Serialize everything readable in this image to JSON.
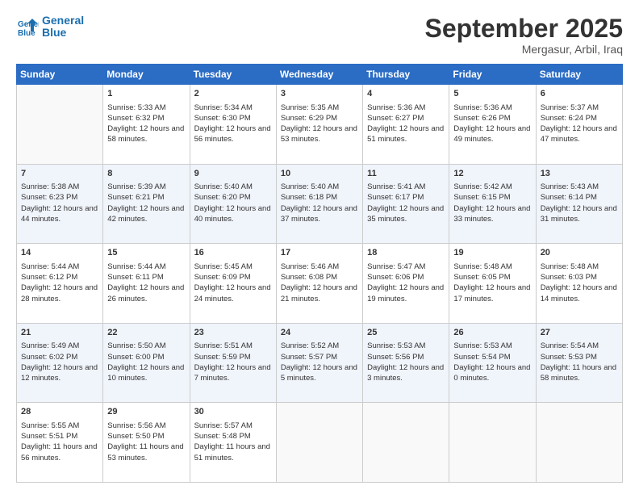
{
  "header": {
    "logo_line1": "General",
    "logo_line2": "Blue",
    "month": "September 2025",
    "location": "Mergasur, Arbil, Iraq"
  },
  "days_of_week": [
    "Sunday",
    "Monday",
    "Tuesday",
    "Wednesday",
    "Thursday",
    "Friday",
    "Saturday"
  ],
  "weeks": [
    [
      {
        "day": "",
        "sunrise": "",
        "sunset": "",
        "daylight": ""
      },
      {
        "day": "1",
        "sunrise": "Sunrise: 5:33 AM",
        "sunset": "Sunset: 6:32 PM",
        "daylight": "Daylight: 12 hours and 58 minutes."
      },
      {
        "day": "2",
        "sunrise": "Sunrise: 5:34 AM",
        "sunset": "Sunset: 6:30 PM",
        "daylight": "Daylight: 12 hours and 56 minutes."
      },
      {
        "day": "3",
        "sunrise": "Sunrise: 5:35 AM",
        "sunset": "Sunset: 6:29 PM",
        "daylight": "Daylight: 12 hours and 53 minutes."
      },
      {
        "day": "4",
        "sunrise": "Sunrise: 5:36 AM",
        "sunset": "Sunset: 6:27 PM",
        "daylight": "Daylight: 12 hours and 51 minutes."
      },
      {
        "day": "5",
        "sunrise": "Sunrise: 5:36 AM",
        "sunset": "Sunset: 6:26 PM",
        "daylight": "Daylight: 12 hours and 49 minutes."
      },
      {
        "day": "6",
        "sunrise": "Sunrise: 5:37 AM",
        "sunset": "Sunset: 6:24 PM",
        "daylight": "Daylight: 12 hours and 47 minutes."
      }
    ],
    [
      {
        "day": "7",
        "sunrise": "Sunrise: 5:38 AM",
        "sunset": "Sunset: 6:23 PM",
        "daylight": "Daylight: 12 hours and 44 minutes."
      },
      {
        "day": "8",
        "sunrise": "Sunrise: 5:39 AM",
        "sunset": "Sunset: 6:21 PM",
        "daylight": "Daylight: 12 hours and 42 minutes."
      },
      {
        "day": "9",
        "sunrise": "Sunrise: 5:40 AM",
        "sunset": "Sunset: 6:20 PM",
        "daylight": "Daylight: 12 hours and 40 minutes."
      },
      {
        "day": "10",
        "sunrise": "Sunrise: 5:40 AM",
        "sunset": "Sunset: 6:18 PM",
        "daylight": "Daylight: 12 hours and 37 minutes."
      },
      {
        "day": "11",
        "sunrise": "Sunrise: 5:41 AM",
        "sunset": "Sunset: 6:17 PM",
        "daylight": "Daylight: 12 hours and 35 minutes."
      },
      {
        "day": "12",
        "sunrise": "Sunrise: 5:42 AM",
        "sunset": "Sunset: 6:15 PM",
        "daylight": "Daylight: 12 hours and 33 minutes."
      },
      {
        "day": "13",
        "sunrise": "Sunrise: 5:43 AM",
        "sunset": "Sunset: 6:14 PM",
        "daylight": "Daylight: 12 hours and 31 minutes."
      }
    ],
    [
      {
        "day": "14",
        "sunrise": "Sunrise: 5:44 AM",
        "sunset": "Sunset: 6:12 PM",
        "daylight": "Daylight: 12 hours and 28 minutes."
      },
      {
        "day": "15",
        "sunrise": "Sunrise: 5:44 AM",
        "sunset": "Sunset: 6:11 PM",
        "daylight": "Daylight: 12 hours and 26 minutes."
      },
      {
        "day": "16",
        "sunrise": "Sunrise: 5:45 AM",
        "sunset": "Sunset: 6:09 PM",
        "daylight": "Daylight: 12 hours and 24 minutes."
      },
      {
        "day": "17",
        "sunrise": "Sunrise: 5:46 AM",
        "sunset": "Sunset: 6:08 PM",
        "daylight": "Daylight: 12 hours and 21 minutes."
      },
      {
        "day": "18",
        "sunrise": "Sunrise: 5:47 AM",
        "sunset": "Sunset: 6:06 PM",
        "daylight": "Daylight: 12 hours and 19 minutes."
      },
      {
        "day": "19",
        "sunrise": "Sunrise: 5:48 AM",
        "sunset": "Sunset: 6:05 PM",
        "daylight": "Daylight: 12 hours and 17 minutes."
      },
      {
        "day": "20",
        "sunrise": "Sunrise: 5:48 AM",
        "sunset": "Sunset: 6:03 PM",
        "daylight": "Daylight: 12 hours and 14 minutes."
      }
    ],
    [
      {
        "day": "21",
        "sunrise": "Sunrise: 5:49 AM",
        "sunset": "Sunset: 6:02 PM",
        "daylight": "Daylight: 12 hours and 12 minutes."
      },
      {
        "day": "22",
        "sunrise": "Sunrise: 5:50 AM",
        "sunset": "Sunset: 6:00 PM",
        "daylight": "Daylight: 12 hours and 10 minutes."
      },
      {
        "day": "23",
        "sunrise": "Sunrise: 5:51 AM",
        "sunset": "Sunset: 5:59 PM",
        "daylight": "Daylight: 12 hours and 7 minutes."
      },
      {
        "day": "24",
        "sunrise": "Sunrise: 5:52 AM",
        "sunset": "Sunset: 5:57 PM",
        "daylight": "Daylight: 12 hours and 5 minutes."
      },
      {
        "day": "25",
        "sunrise": "Sunrise: 5:53 AM",
        "sunset": "Sunset: 5:56 PM",
        "daylight": "Daylight: 12 hours and 3 minutes."
      },
      {
        "day": "26",
        "sunrise": "Sunrise: 5:53 AM",
        "sunset": "Sunset: 5:54 PM",
        "daylight": "Daylight: 12 hours and 0 minutes."
      },
      {
        "day": "27",
        "sunrise": "Sunrise: 5:54 AM",
        "sunset": "Sunset: 5:53 PM",
        "daylight": "Daylight: 11 hours and 58 minutes."
      }
    ],
    [
      {
        "day": "28",
        "sunrise": "Sunrise: 5:55 AM",
        "sunset": "Sunset: 5:51 PM",
        "daylight": "Daylight: 11 hours and 56 minutes."
      },
      {
        "day": "29",
        "sunrise": "Sunrise: 5:56 AM",
        "sunset": "Sunset: 5:50 PM",
        "daylight": "Daylight: 11 hours and 53 minutes."
      },
      {
        "day": "30",
        "sunrise": "Sunrise: 5:57 AM",
        "sunset": "Sunset: 5:48 PM",
        "daylight": "Daylight: 11 hours and 51 minutes."
      },
      {
        "day": "",
        "sunrise": "",
        "sunset": "",
        "daylight": ""
      },
      {
        "day": "",
        "sunrise": "",
        "sunset": "",
        "daylight": ""
      },
      {
        "day": "",
        "sunrise": "",
        "sunset": "",
        "daylight": ""
      },
      {
        "day": "",
        "sunrise": "",
        "sunset": "",
        "daylight": ""
      }
    ]
  ]
}
